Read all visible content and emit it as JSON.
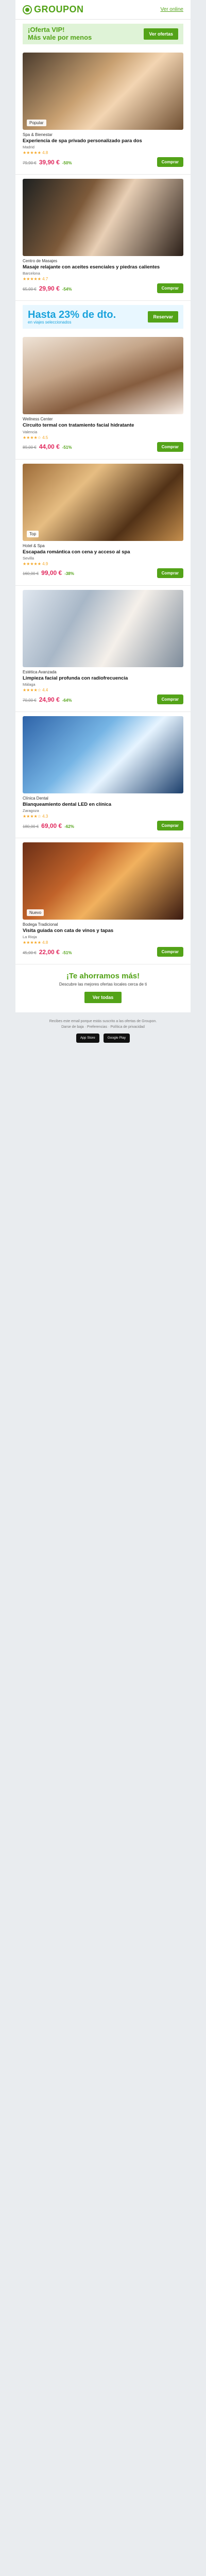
{
  "brand": {
    "name": "GROUPON",
    "color": "#53a318"
  },
  "header": {
    "link": "Ver online"
  },
  "promo": {
    "title_line1": "¡Oferta VIP!",
    "title_line2": "Más vale por menos",
    "button": "Ver ofertas"
  },
  "promo2": {
    "title": "Hasta 23% de dto.",
    "subtitle": "en viajes seleccionados",
    "button": "Reservar"
  },
  "deals": [
    {
      "merchant": "Spa & Bienestar",
      "title": "Experiencia de spa privado personalizado para dos",
      "location": "Madrid",
      "rating": "★★★★★ 4.8",
      "old_price": "79,90 €",
      "price": "39,90 €",
      "discount": "-50%",
      "image_label": "Popular",
      "button": "Comprar"
    },
    {
      "merchant": "Centro de Masajes",
      "title": "Masaje relajante con aceites esenciales y piedras calientes",
      "location": "Barcelona",
      "rating": "★★★★★ 4.7",
      "old_price": "65,00 €",
      "price": "29,90 €",
      "discount": "-54%",
      "image_label": "",
      "button": "Comprar"
    },
    {
      "merchant": "Wellness Center",
      "title": "Circuito termal con tratamiento facial hidratante",
      "location": "Valencia",
      "rating": "★★★★☆ 4.5",
      "old_price": "89,00 €",
      "price": "44,00 €",
      "discount": "-51%",
      "image_label": "",
      "button": "Comprar"
    },
    {
      "merchant": "Hotel & Spa",
      "title": "Escapada romántica con cena y acceso al spa",
      "location": "Sevilla",
      "rating": "★★★★★ 4.9",
      "old_price": "160,00 €",
      "price": "99,00 €",
      "discount": "-38%",
      "image_label": "Top",
      "button": "Comprar"
    },
    {
      "merchant": "Estética Avanzada",
      "title": "Limpieza facial profunda con radiofrecuencia",
      "location": "Málaga",
      "rating": "★★★★☆ 4.4",
      "old_price": "70,00 €",
      "price": "24,90 €",
      "discount": "-64%",
      "image_label": "",
      "button": "Comprar"
    },
    {
      "merchant": "Clínica Dental",
      "title": "Blanqueamiento dental LED en clínica",
      "location": "Zaragoza",
      "rating": "★★★★☆ 4.3",
      "old_price": "180,00 €",
      "price": "69,00 €",
      "discount": "-62%",
      "image_label": "",
      "button": "Comprar"
    },
    {
      "merchant": "Bodega Tradicional",
      "title": "Visita guiada con cata de vinos y tapas",
      "location": "La Rioja",
      "rating": "★★★★★ 4.8",
      "old_price": "45,00 €",
      "price": "22,00 €",
      "discount": "-51%",
      "image_label": "Nuevo",
      "button": "Comprar"
    }
  ],
  "footer": {
    "title": "¡Te ahorramos más!",
    "subtitle": "Descubre las mejores ofertas locales cerca de ti",
    "button": "Ver todas"
  },
  "bottom": {
    "line1": "Recibes este email porque estás suscrito a las ofertas de Groupon.",
    "line2": "Darse de baja · Preferencias · Política de privacidad",
    "app_store": "App Store",
    "google_play": "Google Play"
  }
}
